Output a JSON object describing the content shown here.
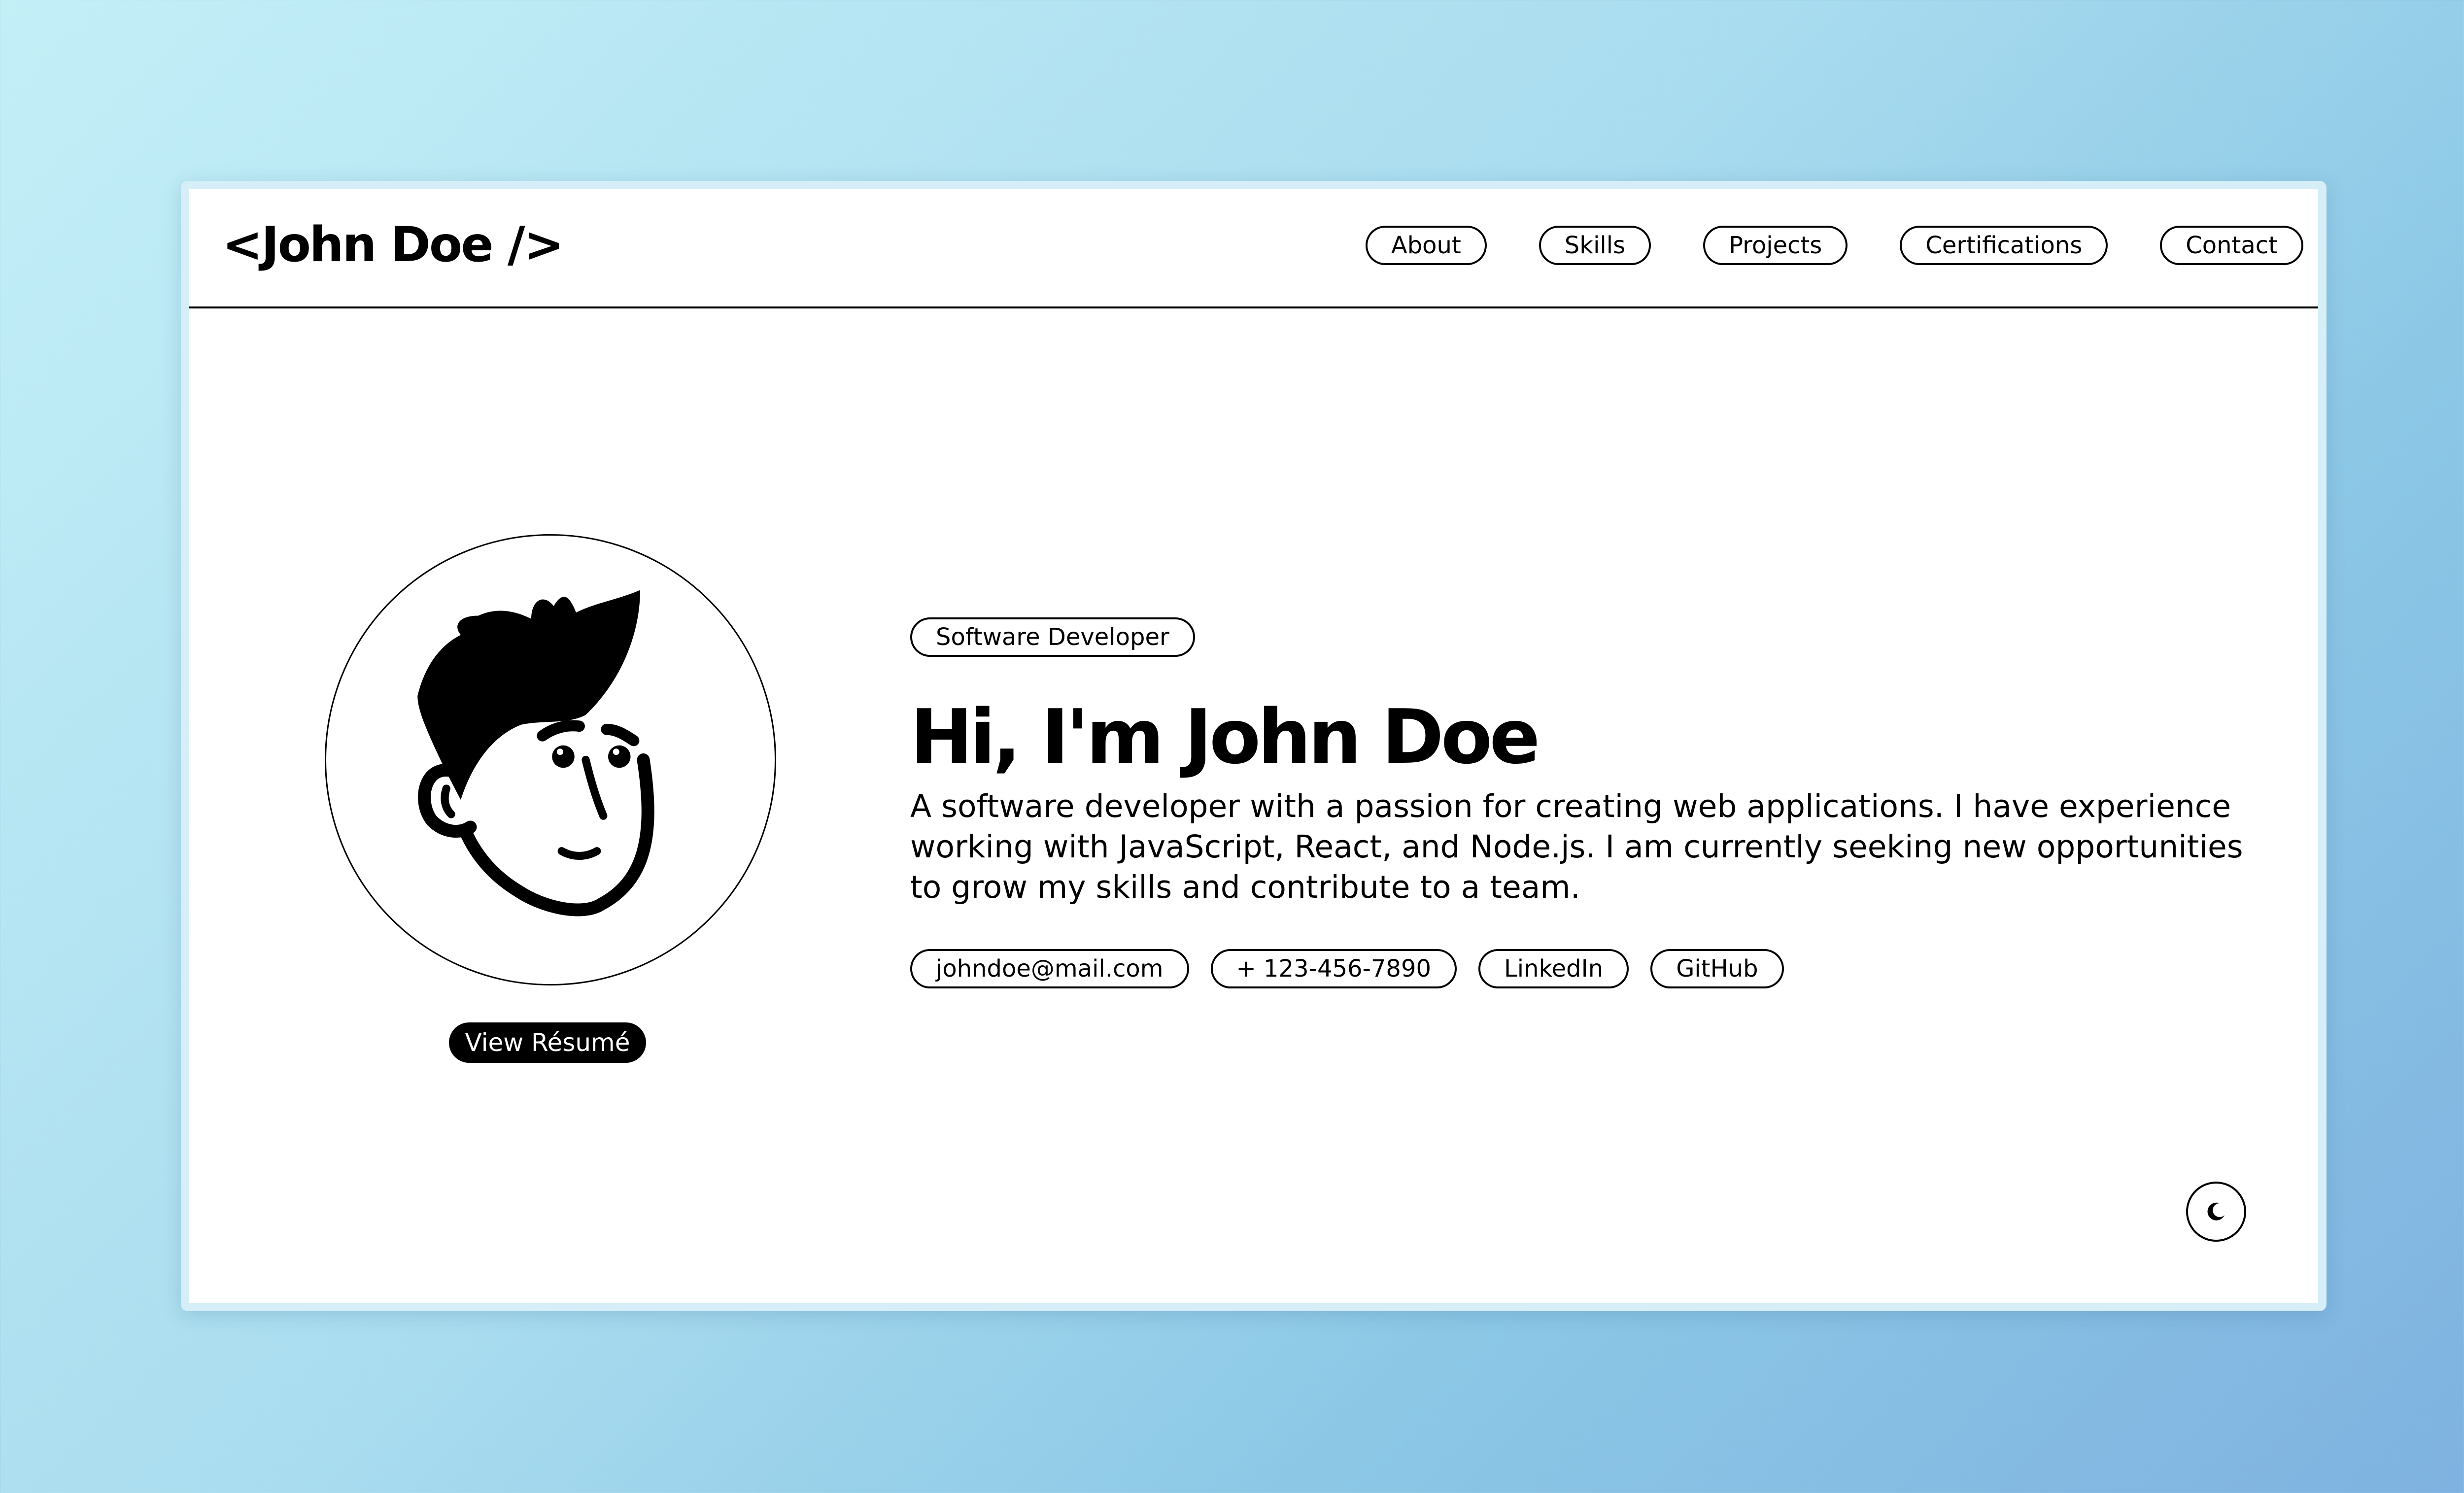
{
  "header": {
    "logo": "<John Doe />"
  },
  "nav": {
    "items": [
      {
        "label": "About"
      },
      {
        "label": "Skills"
      },
      {
        "label": "Projects"
      },
      {
        "label": "Certifications"
      },
      {
        "label": "Contact"
      }
    ]
  },
  "profile": {
    "resume_label": "View Résumé"
  },
  "hero": {
    "role_badge": "Software Developer",
    "title": "Hi, I'm John Doe",
    "description": "A software developer with a passion for creating web applications. I have experience working with JavaScript, React, and Node.js. I am currently seeking new opportunities to grow my skills and contribute to a team."
  },
  "contacts": [
    {
      "label": "johndoe@mail.com"
    },
    {
      "label": "+ 123-456-7890"
    },
    {
      "label": "LinkedIn"
    },
    {
      "label": "GitHub"
    }
  ],
  "theme_toggle": {
    "icon": "moon-icon"
  },
  "colors": {
    "background_gradient_start": "#c3eff7",
    "background_gradient_end": "#7fb2e0",
    "text": "#000000",
    "surface": "#ffffff",
    "button_dark": "#000000"
  }
}
